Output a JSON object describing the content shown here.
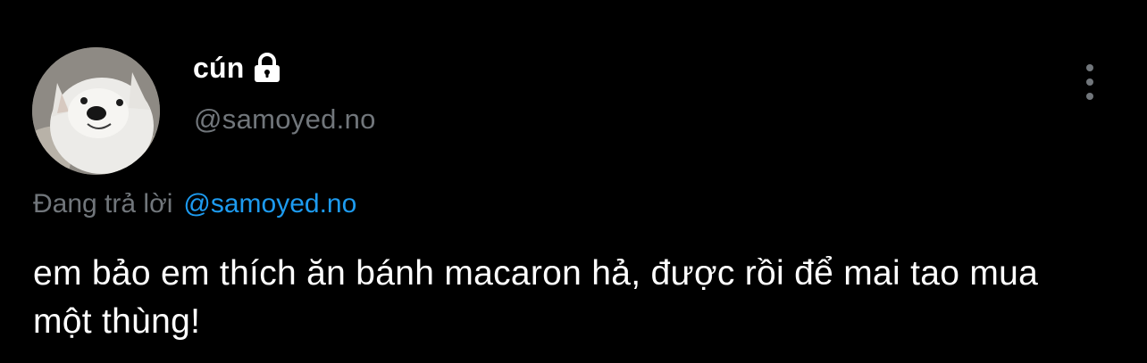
{
  "author": {
    "display_name": "cún",
    "handle": "@samoyed.no",
    "protected_icon": "lock-icon",
    "avatar": "samoyed-dog-photo"
  },
  "reply_context": {
    "prefix": "Đang trả lời",
    "mention": "@samoyed.no"
  },
  "tweet": {
    "text": "em bảo em thích ăn bánh macaron hả, được rồi để mai tao mua một thùng!"
  },
  "menu": {
    "icon": "more-vertical-icon"
  },
  "colors": {
    "background": "#000000",
    "primary_text": "#ffffff",
    "secondary_text": "#71767b",
    "link": "#1d9bf0"
  }
}
